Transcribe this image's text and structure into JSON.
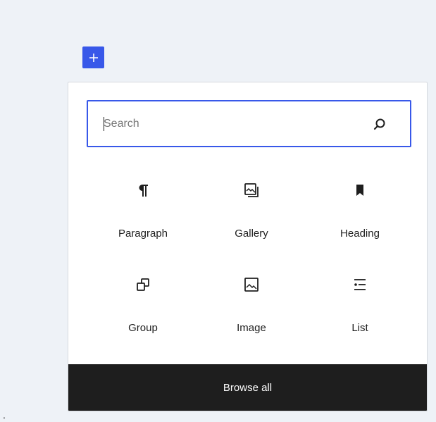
{
  "colors": {
    "accent": "#3858e9",
    "page_background": "#eef2f7",
    "browse_bar": "#1e1e1e"
  },
  "add_button": {
    "icon": "plus-icon"
  },
  "search": {
    "placeholder": "Search",
    "value": "",
    "icon": "search-icon"
  },
  "blocks": [
    {
      "label": "Paragraph",
      "icon": "paragraph-icon"
    },
    {
      "label": "Gallery",
      "icon": "gallery-icon"
    },
    {
      "label": "Heading",
      "icon": "bookmark-icon"
    },
    {
      "label": "Group",
      "icon": "group-icon"
    },
    {
      "label": "Image",
      "icon": "image-icon"
    },
    {
      "label": "List",
      "icon": "list-icon"
    }
  ],
  "browse_all": {
    "label": "Browse all"
  },
  "stray_text": "."
}
